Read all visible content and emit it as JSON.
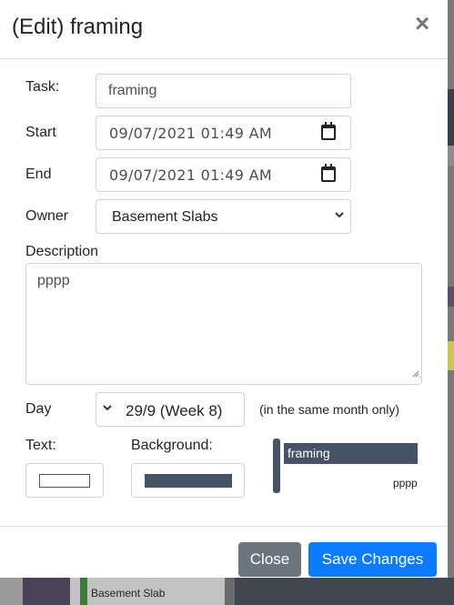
{
  "modal": {
    "title": "(Edit) framing",
    "close_glyph": "×"
  },
  "form": {
    "task_label": "Task:",
    "task_value": "framing",
    "start_label": "Start",
    "start_value": "09/07/2021 01:49 AM",
    "end_label": "End",
    "end_value": "09/07/2021 01:49 AM",
    "owner_label": "Owner",
    "owner_value": "Basement Slabs",
    "description_label": "Description",
    "description_value": "pppp",
    "day_label": "Day",
    "day_value": "29/9 (Week 8)",
    "day_hint": "(in the same month only)",
    "text_label": "Text:",
    "background_label": "Background:"
  },
  "colors": {
    "text_color": "#ffffff",
    "background_color": "#465366",
    "primary_button": "#0d7bff",
    "secondary_button": "#6c757d"
  },
  "preview": {
    "task_text": "framing",
    "description_text": "pppp"
  },
  "footer": {
    "close_label": "Close",
    "save_label": "Save Changes"
  },
  "backdrop": {
    "task_label": "Basement Slab"
  },
  "icons": {
    "close": "close-icon",
    "calendar": "calendar-icon",
    "chevron": "chevron-down-icon",
    "resize": "resize-grip-icon"
  }
}
